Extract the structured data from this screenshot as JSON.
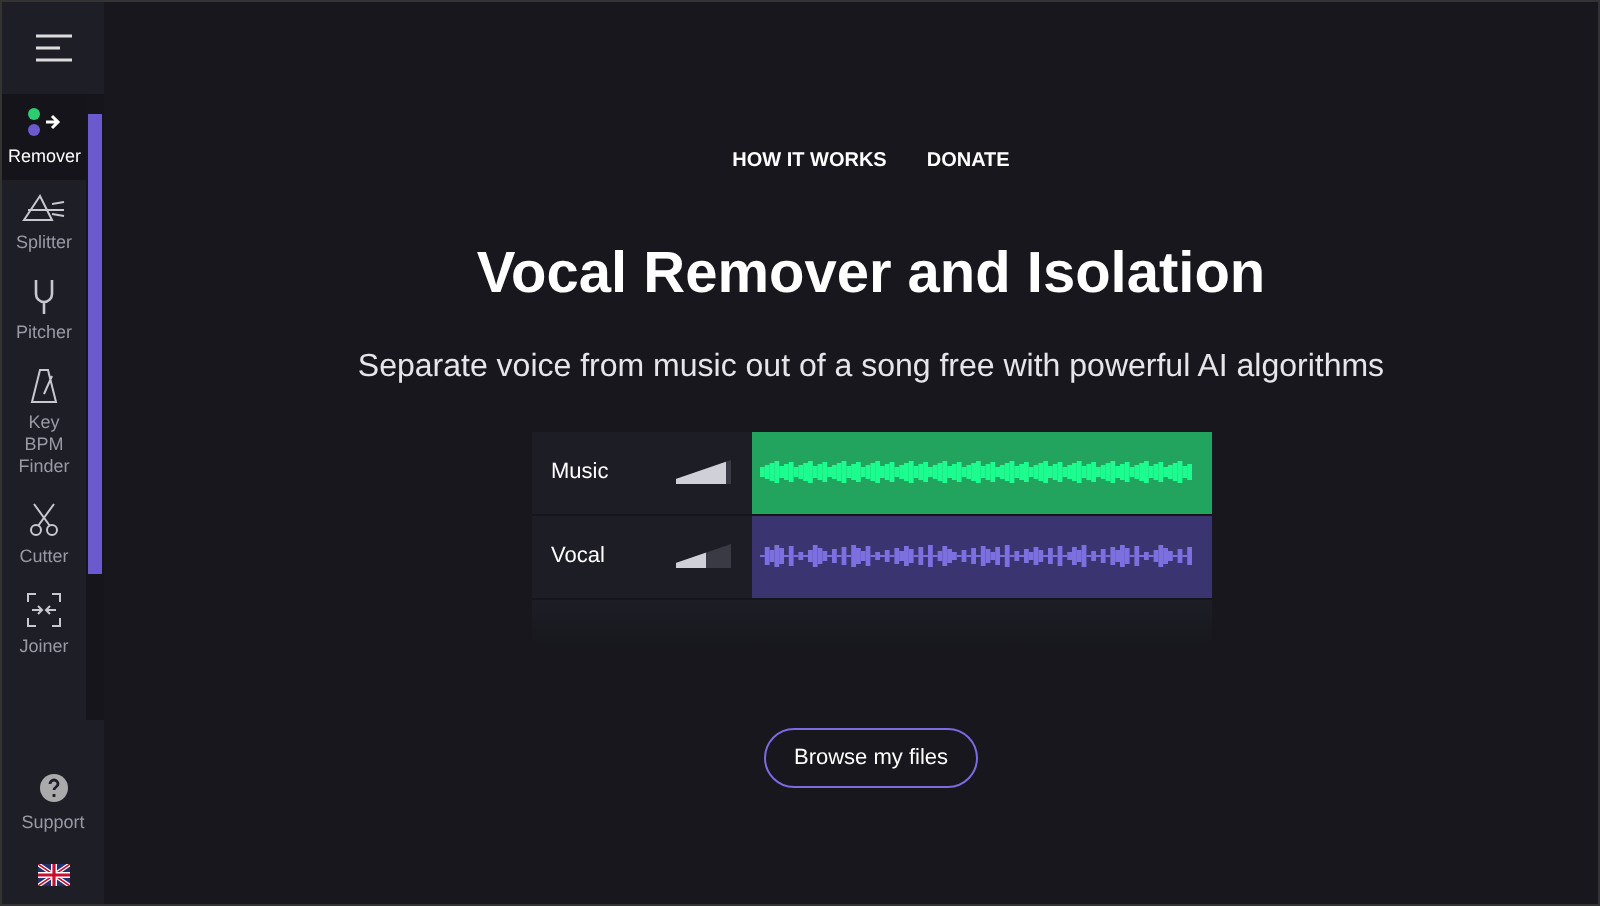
{
  "sidebar": {
    "items": [
      {
        "label": "Remover",
        "kind": "dots",
        "selected": true
      },
      {
        "label": "Splitter",
        "kind": "prism",
        "selected": false
      },
      {
        "label": "Pitcher",
        "kind": "fork",
        "selected": false
      },
      {
        "label": "Key BPM Finder",
        "kind": "metronome",
        "selected": false
      },
      {
        "label": "Cutter",
        "kind": "scissors",
        "selected": false
      },
      {
        "label": "Joiner",
        "kind": "join",
        "selected": false
      }
    ],
    "support": "Support"
  },
  "nav": [
    "HOW IT WORKS",
    "DONATE"
  ],
  "title": "Vocal Remover and Isolation",
  "subtitle": "Separate voice from music out of a song free with powerful AI algorithms",
  "tracks": [
    {
      "name": "Music",
      "kind": "music",
      "level": 0.9
    },
    {
      "name": "Vocal",
      "kind": "vocal",
      "level": 0.55
    }
  ],
  "browse_button": "Browse my files"
}
